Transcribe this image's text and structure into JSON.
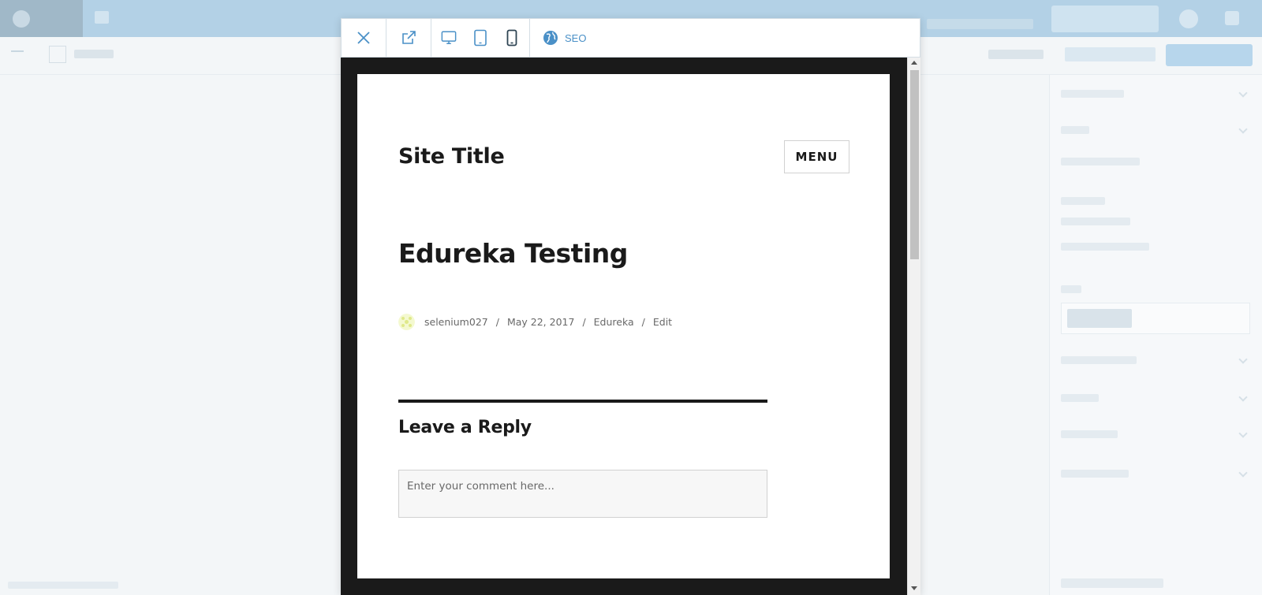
{
  "toolbar": {
    "close_icon": "close-icon",
    "external_icon": "external-link-icon",
    "devices": [
      "desktop-icon",
      "tablet-icon",
      "phone-icon"
    ],
    "selected_device": "phone",
    "seo_label": "SEO"
  },
  "site": {
    "title": "Site Title",
    "menu_label": "MENU"
  },
  "post": {
    "title": "Edureka Testing",
    "meta": {
      "author": "selenium027",
      "date": "May 22, 2017",
      "category": "Edureka",
      "edit": "Edit",
      "separator": "/"
    }
  },
  "comments": {
    "title": "Leave a Reply",
    "placeholder": "Enter your comment here..."
  },
  "colors": {
    "accent": "#4a90c7",
    "text": "#1a1a1a",
    "meta": "#686868",
    "frame_border": "#1a1a1a"
  }
}
